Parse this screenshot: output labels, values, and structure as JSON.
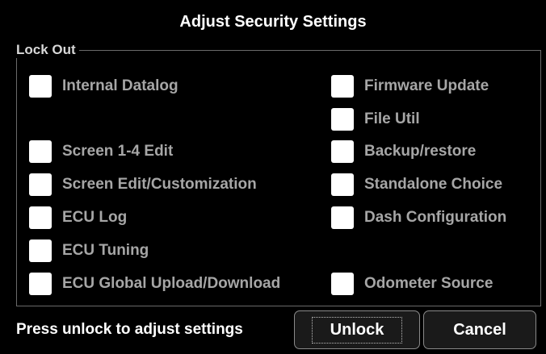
{
  "dialog": {
    "title": "Adjust Security Settings"
  },
  "lockout": {
    "legend": "Lock Out",
    "left_options": [
      {
        "label": "Internal Datalog",
        "checked": false
      },
      {
        "label": "Screen 1-4 Edit",
        "checked": false
      },
      {
        "label": "Screen Edit/Customization",
        "checked": false
      },
      {
        "label": "ECU Log",
        "checked": false
      },
      {
        "label": "ECU Tuning",
        "checked": false
      },
      {
        "label": "ECU Global Upload/Download",
        "checked": false
      }
    ],
    "right_options": [
      {
        "label": "Firmware Update",
        "checked": false
      },
      {
        "label": "File Util",
        "checked": false
      },
      {
        "label": "Backup/restore",
        "checked": false
      },
      {
        "label": "Standalone Choice",
        "checked": false
      },
      {
        "label": "Dash Configuration",
        "checked": false
      },
      {
        "label": "Odometer Source",
        "checked": false
      }
    ]
  },
  "footer": {
    "prompt": "Press unlock to adjust settings",
    "unlock_label": "Unlock",
    "cancel_label": "Cancel"
  },
  "colors": {
    "background": "#000000",
    "checkbox": "#ffffff",
    "disabled_label": "#a6a6a6",
    "border": "#6a6a6a"
  }
}
